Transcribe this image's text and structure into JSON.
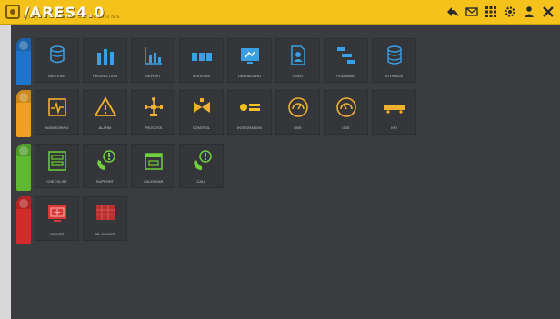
{
  "app": {
    "logo_text": "/ARES4.0",
    "logo_subtitle": "DIGITAL TWIN SOLUTIONS"
  },
  "topbar": {
    "icons": [
      "back-icon",
      "mail-icon",
      "grid-icon",
      "settings-icon",
      "user-icon",
      "close-icon"
    ]
  },
  "colors": {
    "topbar": "#f5c21b",
    "blue": "#1e74c8",
    "orange": "#f0a020",
    "green": "#5fb830",
    "red": "#d32b2b"
  },
  "rows": [
    {
      "color": "#1e74c8",
      "tiles": [
        {
          "icon": "database-icon",
          "label": "MES ENG"
        },
        {
          "icon": "bar-chart-icon",
          "label": "PRODUCTION"
        },
        {
          "icon": "chart-icon",
          "label": "REPORT"
        },
        {
          "icon": "stations-icon",
          "label": "STATIONS"
        },
        {
          "icon": "monitor-icon",
          "label": "DASHBOARD"
        },
        {
          "icon": "user-doc-icon",
          "label": "USER"
        },
        {
          "icon": "gantt-icon",
          "label": "PLANNING"
        },
        {
          "icon": "storage-icon",
          "label": "STORAGE"
        }
      ]
    },
    {
      "color": "#f0a020",
      "tiles": [
        {
          "icon": "signal-icon",
          "label": "MONITORING"
        },
        {
          "icon": "warning-icon",
          "label": "ALARM"
        },
        {
          "icon": "robot-icon",
          "label": "PROCESS"
        },
        {
          "icon": "valve-icon",
          "label": "CONTROL"
        },
        {
          "icon": "brand-logo-icon",
          "label": "INTEGRATION"
        },
        {
          "icon": "gauge-icon",
          "label": "OEE"
        },
        {
          "icon": "gauge-icon",
          "label": "OEE"
        },
        {
          "icon": "train-icon",
          "label": "KPI"
        }
      ]
    },
    {
      "color": "#5fb830",
      "tiles": [
        {
          "icon": "form-icon",
          "label": "CHECKLIST"
        },
        {
          "icon": "phone-alert-icon",
          "label": "SUPPORT"
        },
        {
          "icon": "calendar-icon",
          "label": "CALENDAR"
        },
        {
          "icon": "phone-alert-icon",
          "label": "CALL"
        }
      ]
    },
    {
      "color": "#d32b2b",
      "tiles": [
        {
          "icon": "screen-icon",
          "label": "VIEWER"
        },
        {
          "icon": "grid-screen-icon",
          "label": "3D VIEWER"
        }
      ]
    }
  ],
  "footer": {
    "text": ""
  }
}
